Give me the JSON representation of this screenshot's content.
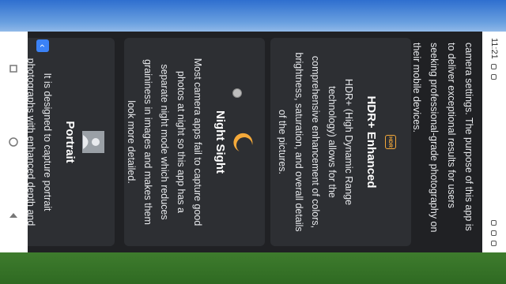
{
  "status": {
    "time": "11:21"
  },
  "intro": {
    "text": "camera settings. The purpose of this app is to deliver exceptional results for users seeking professional-grade photography on their mobile devices."
  },
  "cards": [
    {
      "badge": "HDR",
      "title": "HDR+ Enhanced",
      "body": "HDR+ (High Dynamic Range technology) allows for the comprehensive enhancement of colors, brightness, saturation, and overall details of the pictures."
    },
    {
      "title": "Night Sight",
      "body": "Most camera apps fail to capture good photos at night so this app has a separate night mode which reduces graininess in images and makes them look more detailed."
    },
    {
      "title": "Portrait",
      "body": "It is designed to capture portrait photographs with enhanced depth and clarity. You can use this mode to only focus on subject and let"
    }
  ],
  "back_button": {
    "icon": "chevron-left-icon",
    "glyph": "‹"
  },
  "colors": {
    "accent": "#f4a93a",
    "card_bg": "#2d2f33",
    "page_bg": "#202124",
    "button": "#3b82f6"
  }
}
